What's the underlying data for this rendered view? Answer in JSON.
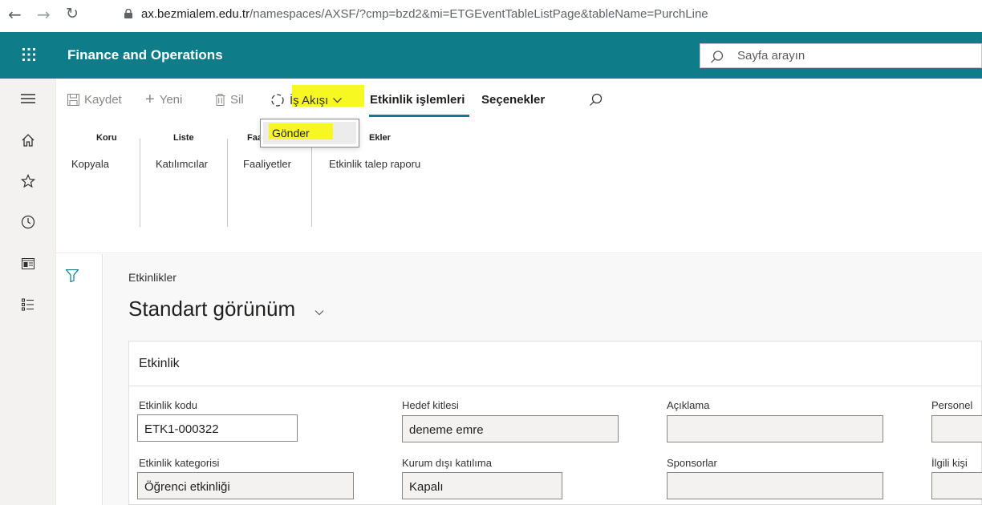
{
  "browser": {
    "url_domain": "ax.bezmialem.edu.tr",
    "url_path": "/namespaces/AXSF/?cmp=bzd2&mi=ETGEventTableListPage&tableName=PurchLine"
  },
  "app": {
    "title": "Finance and Operations",
    "search_placeholder": "Sayfa arayın"
  },
  "toolbar": {
    "save_label": "Kaydet",
    "new_label": "Yeni",
    "delete_label": "Sil",
    "workflow_label": "İş Akışı",
    "tab_event_ops": "Etkinlik işlemleri",
    "tab_options": "Seçenekler"
  },
  "workflow_menu": {
    "items": [
      "Gönder"
    ]
  },
  "ribbon": {
    "groups": [
      {
        "title": "Koru",
        "items": [
          "Kopyala"
        ]
      },
      {
        "title": "Liste",
        "items": [
          "Katılımcılar"
        ]
      },
      {
        "title": "Faa",
        "items": [
          "Faaliyetler"
        ]
      },
      {
        "title": "Ekler",
        "items": [
          "Etkinlik talep raporu"
        ]
      }
    ]
  },
  "page": {
    "caption": "Etkinlikler",
    "view_title": "Standart görünüm"
  },
  "card": {
    "title": "Etkinlik",
    "fields": [
      {
        "label": "Etkinlik kodu",
        "value": "ETK1-000322"
      },
      {
        "label": "Hedef kitlesi",
        "value": "deneme emre"
      },
      {
        "label": "Açıklama",
        "value": ""
      },
      {
        "label": "Personel",
        "value": ""
      },
      {
        "label": "Etkinlik kategorisi",
        "value": "Öğrenci etkinliği"
      },
      {
        "label": "Kurum dışı katılıma",
        "value": "Kapalı"
      },
      {
        "label": "Sponsorlar",
        "value": ""
      },
      {
        "label": "İlgili kişi",
        "value": ""
      }
    ]
  },
  "colors": {
    "brand": "#0f7c8a",
    "highlight": "#f7f722"
  }
}
